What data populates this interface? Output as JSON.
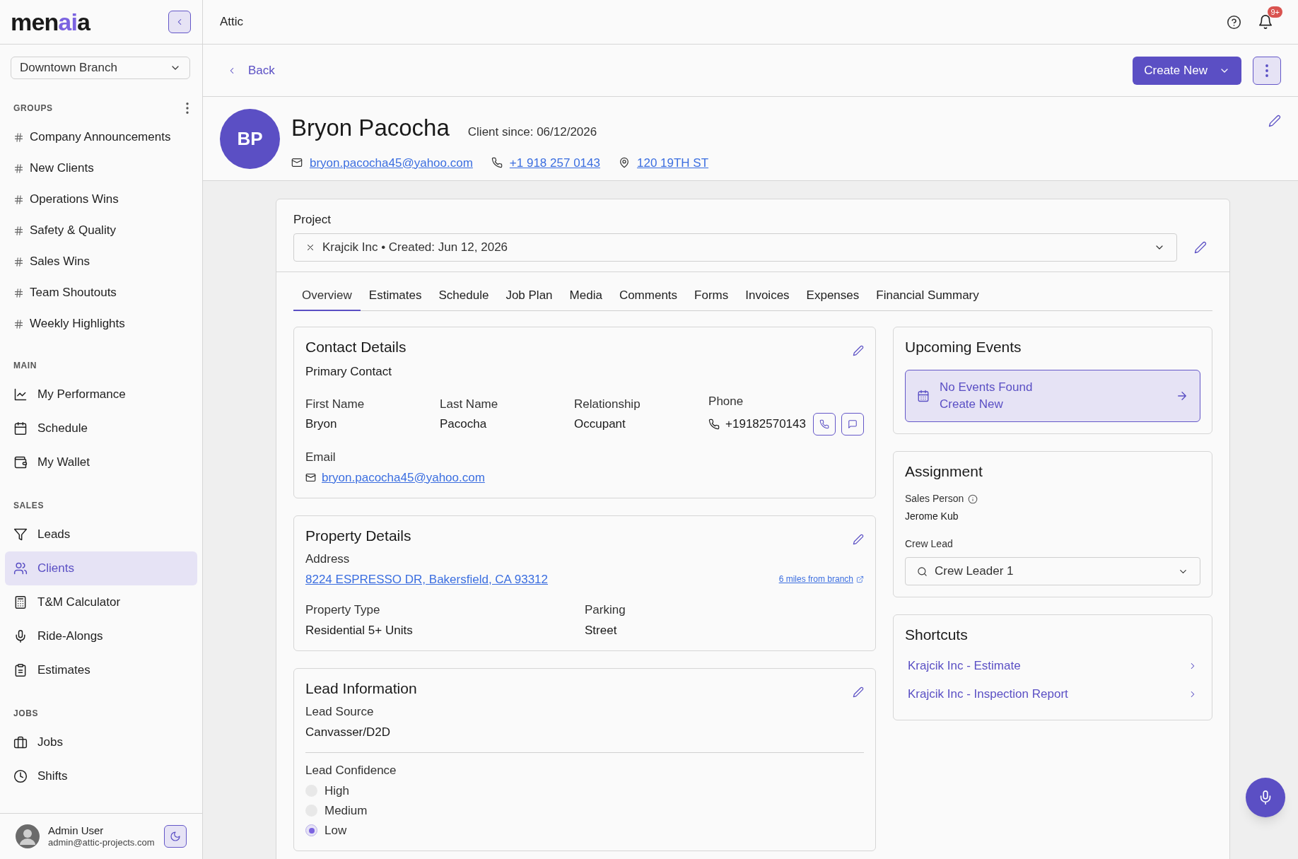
{
  "sidebar": {
    "logo": [
      {
        "text": "men",
        "accent": false
      },
      {
        "text": "ai",
        "accent": true
      },
      {
        "text": "a",
        "accent": false
      }
    ],
    "branch_select": {
      "value": "Downtown Branch"
    },
    "sections": [
      {
        "heading": "GROUPS",
        "kind": "groups",
        "items": [
          {
            "label": "Company Announcements",
            "selected": false
          },
          {
            "label": "New Clients",
            "selected": false
          },
          {
            "label": "Operations Wins",
            "selected": false
          },
          {
            "label": "Safety & Quality",
            "selected": false
          },
          {
            "label": "Sales Wins",
            "selected": false
          },
          {
            "label": "Team Shoutouts",
            "selected": false
          },
          {
            "label": "Weekly Highlights",
            "selected": false
          }
        ]
      },
      {
        "heading": "MAIN",
        "kind": "nav",
        "items": [
          {
            "label": "My Performance",
            "selected": false
          },
          {
            "label": "Schedule",
            "selected": false
          },
          {
            "label": "My Wallet",
            "selected": false
          }
        ]
      },
      {
        "heading": "SALES",
        "kind": "nav",
        "items": [
          {
            "label": "Leads",
            "selected": false
          },
          {
            "label": "Clients",
            "selected": true
          },
          {
            "label": "T&M Calculator",
            "selected": false
          },
          {
            "label": "Ride-Alongs",
            "selected": false
          },
          {
            "label": "Estimates",
            "selected": false
          }
        ]
      },
      {
        "heading": "JOBS",
        "kind": "nav",
        "items": [
          {
            "label": "Jobs",
            "selected": false
          },
          {
            "label": "Shifts",
            "selected": false
          }
        ]
      }
    ],
    "user": {
      "name": "Admin User",
      "email": "admin@attic-projects.com"
    }
  },
  "header": {
    "title": "Attic",
    "notification_badge": "9+"
  },
  "toolbar": {
    "back": "Back",
    "create_button": "Create New"
  },
  "client": {
    "initials": "BP",
    "name": "Bryon Pacocha",
    "since": "Client since: 06/12/2026",
    "email": "bryon.pacocha45@yahoo.com",
    "phone": "+1 918 257 0143",
    "address": "120 19TH ST"
  },
  "project": {
    "label": "Project",
    "value": "Krajcik Inc • Created: Jun 12, 2026"
  },
  "tabs": [
    {
      "label": "Overview",
      "selected": true
    },
    {
      "label": "Estimates",
      "selected": false
    },
    {
      "label": "Schedule",
      "selected": false
    },
    {
      "label": "Job Plan",
      "selected": false
    },
    {
      "label": "Media",
      "selected": false
    },
    {
      "label": "Comments",
      "selected": false
    },
    {
      "label": "Forms",
      "selected": false
    },
    {
      "label": "Invoices",
      "selected": false
    },
    {
      "label": "Expenses",
      "selected": false
    },
    {
      "label": "Financial Summary",
      "selected": false
    }
  ],
  "contact_details": {
    "title": "Contact Details",
    "subtitle": "Primary Contact",
    "fields": [
      {
        "label": "First Name",
        "value": "Bryon",
        "kind": "text"
      },
      {
        "label": "Last Name",
        "value": "Pacocha",
        "kind": "text"
      },
      {
        "label": "Relationship",
        "value": "Occupant",
        "kind": "text"
      },
      {
        "label": "Phone",
        "value": "+19182570143",
        "kind": "phone"
      }
    ],
    "email_label": "Email",
    "email": "bryon.pacocha45@yahoo.com"
  },
  "property_details": {
    "title": "Property Details",
    "address_label": "Address",
    "address": "8224 ESPRESSO DR, Bakersfield, CA 93312",
    "distance": "6 miles from branch",
    "fields": [
      {
        "label": "Property Type",
        "value": "Residential 5+ Units"
      },
      {
        "label": "Parking",
        "value": "Street"
      }
    ]
  },
  "lead_information": {
    "title": "Lead Information",
    "source_label": "Lead Source",
    "source": "Canvasser/D2D",
    "confidence_label": "Lead Confidence",
    "options": [
      {
        "label": "High",
        "selected": false
      },
      {
        "label": "Medium",
        "selected": false
      },
      {
        "label": "Low",
        "selected": true
      }
    ]
  },
  "upcoming_events": {
    "title": "Upcoming Events",
    "empty": "No Events Found",
    "action": "Create New"
  },
  "assignment": {
    "title": "Assignment",
    "sales_label": "Sales Person",
    "sales_person": "Jerome Kub",
    "crew_label": "Crew Lead",
    "crew_lead": "Crew Leader 1"
  },
  "shortcuts": {
    "title": "Shortcuts",
    "items": [
      "Krajcik Inc - Estimate",
      "Krajcik Inc - Inspection Report"
    ]
  }
}
